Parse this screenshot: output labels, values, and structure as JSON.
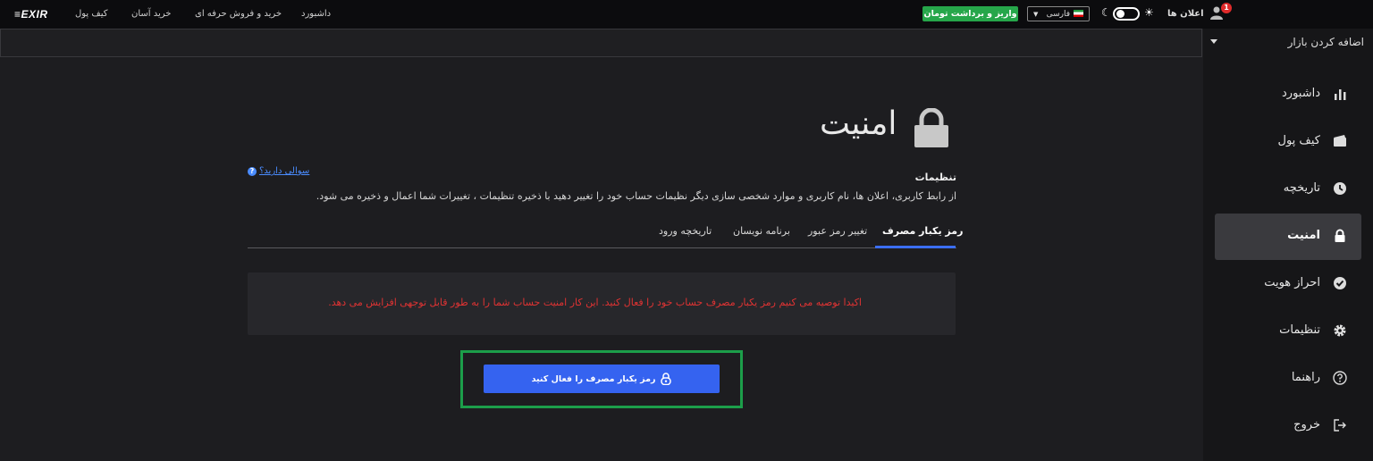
{
  "topbar": {
    "logo": "EXIR",
    "nav": [
      "داشبورد",
      "خرید و فروش حرفه ای",
      "خرید آسان",
      "کیف پول"
    ],
    "deposit_button": "واریز و برداشت تومان",
    "language": "فارسی",
    "notifications_label": "اعلان ها",
    "notification_count": "1"
  },
  "market": {
    "add_label": "اضافه کردن بازار"
  },
  "sidebar": {
    "items": [
      {
        "label": "داشبورد",
        "icon": "bar-chart-icon"
      },
      {
        "label": "کیف پول",
        "icon": "wallet-icon"
      },
      {
        "label": "تاریخچه",
        "icon": "clock-icon"
      },
      {
        "label": "امنیت",
        "icon": "lock-icon",
        "active": true
      },
      {
        "label": "احراز هویت",
        "icon": "check-circle-icon"
      },
      {
        "label": "تنظیمات",
        "icon": "gear-icon"
      },
      {
        "label": "راهنما",
        "icon": "question-icon"
      },
      {
        "label": "خروج",
        "icon": "logout-icon"
      }
    ]
  },
  "main": {
    "title": "امنیت",
    "help_link": "سوالی دارید؟",
    "help_icon": "?",
    "settings_heading": "تنظیمات",
    "settings_desc": "از رابط کاربری، اعلان ها، نام کاربری و موارد شخصی سازی دیگر نظیمات حساب خود را تغییر دهید با ذخیره تنظیمات ، تغییرات شما اعمال و ذخیره می شود.",
    "tabs": [
      "رمز یکبار مصرف",
      "تغییر رمز عبور",
      "برنامه نویسان",
      "تاریخچه ورود"
    ],
    "alert": "اکیدا توصیه می کنیم رمز یکبار مصرف حساب خود را فعال کنید. این کار امنیت حساب شما را به طور قابل توجهی افزایش می دهد.",
    "enable_button": "رمز یکبار مصرف را فعال کنید"
  },
  "colors": {
    "accent": "#3563f0",
    "deposit": "#26a64a",
    "alert": "#e03333",
    "highlight": "#1c9e4a"
  }
}
